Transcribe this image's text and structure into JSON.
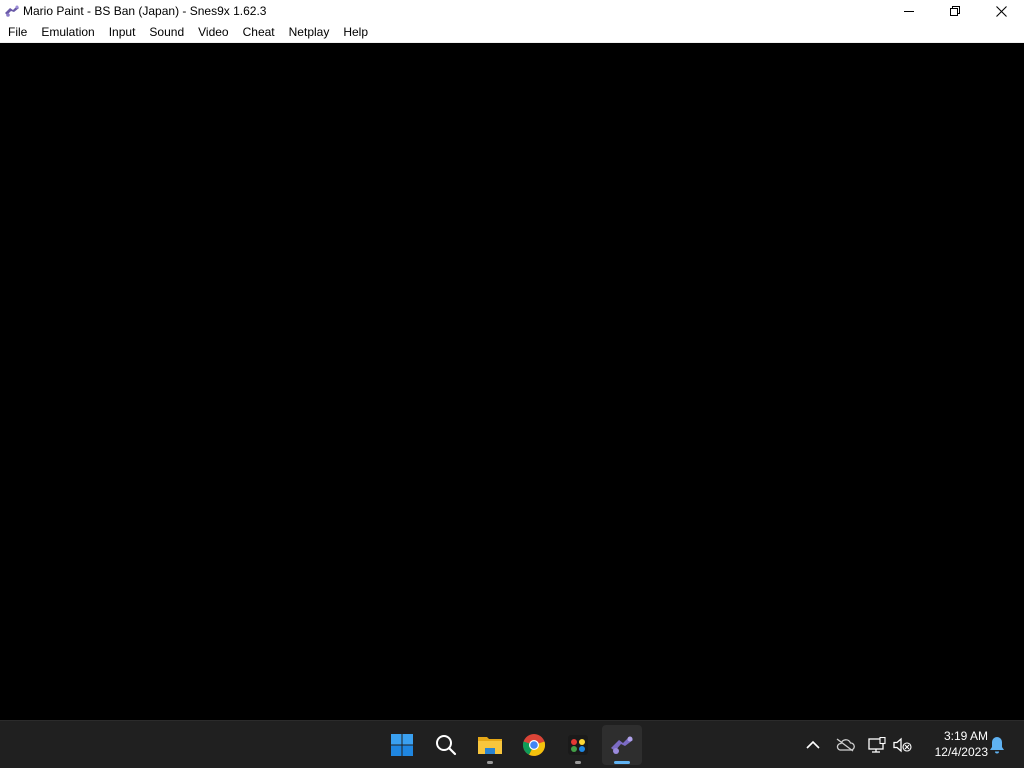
{
  "window": {
    "title": "Mario Paint - BS Ban (Japan) - Snes9x 1.62.3",
    "icon": "snes9x-icon",
    "controls": [
      "minimize-icon",
      "restore-icon",
      "close-icon"
    ]
  },
  "menu": {
    "items": [
      "File",
      "Emulation",
      "Input",
      "Sound",
      "Video",
      "Cheat",
      "Netplay",
      "Help"
    ]
  },
  "taskbar": {
    "apps": [
      {
        "name": "start",
        "icon": "windows-start-icon",
        "active": false,
        "running": false
      },
      {
        "name": "search",
        "icon": "search-icon",
        "active": false,
        "running": false
      },
      {
        "name": "file-explorer",
        "icon": "folder-icon",
        "active": false,
        "running": true
      },
      {
        "name": "chrome",
        "icon": "chrome-icon",
        "active": false,
        "running": false
      },
      {
        "name": "media-app",
        "icon": "media-app-icon",
        "active": false,
        "running": true
      },
      {
        "name": "snes9x",
        "icon": "snes9x-icon",
        "active": true,
        "running": true
      }
    ],
    "tray": {
      "icons": [
        "chevron-up-icon",
        "onedrive-icon",
        "network-icon",
        "volume-muted-icon",
        "notification-bell-icon"
      ],
      "time": "3:19 AM",
      "date": "12/4/2023"
    }
  },
  "colors": {
    "titlebar_bg": "#ffffff",
    "screen_bg": "#000000",
    "taskbar_bg": "#202020",
    "accent": "#5fb2f2"
  }
}
